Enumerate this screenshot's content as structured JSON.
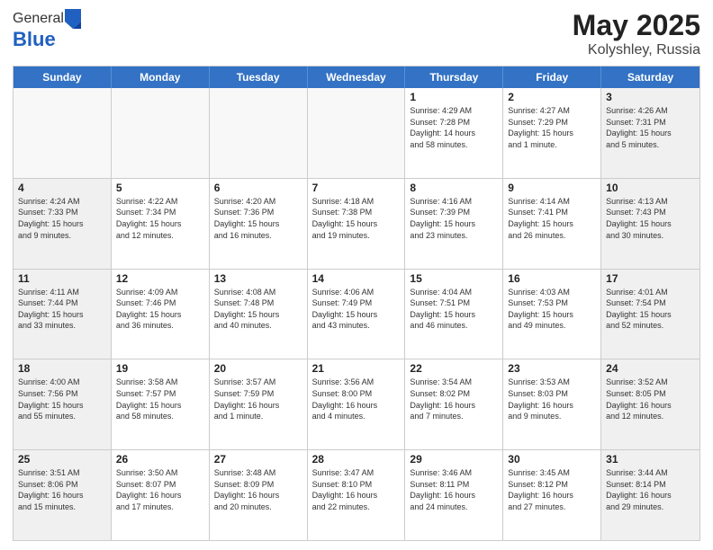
{
  "header": {
    "logo_general": "General",
    "logo_blue": "Blue",
    "title_month": "May 2025",
    "title_location": "Kolyshley, Russia"
  },
  "calendar": {
    "days_of_week": [
      "Sunday",
      "Monday",
      "Tuesday",
      "Wednesday",
      "Thursday",
      "Friday",
      "Saturday"
    ],
    "weeks": [
      [
        {
          "day": "",
          "empty": true
        },
        {
          "day": "",
          "empty": true
        },
        {
          "day": "",
          "empty": true
        },
        {
          "day": "",
          "empty": true
        },
        {
          "day": "1",
          "info": "Sunrise: 4:29 AM\nSunset: 7:28 PM\nDaylight: 14 hours\nand 58 minutes."
        },
        {
          "day": "2",
          "info": "Sunrise: 4:27 AM\nSunset: 7:29 PM\nDaylight: 15 hours\nand 1 minute."
        },
        {
          "day": "3",
          "info": "Sunrise: 4:26 AM\nSunset: 7:31 PM\nDaylight: 15 hours\nand 5 minutes."
        }
      ],
      [
        {
          "day": "4",
          "info": "Sunrise: 4:24 AM\nSunset: 7:33 PM\nDaylight: 15 hours\nand 9 minutes."
        },
        {
          "day": "5",
          "info": "Sunrise: 4:22 AM\nSunset: 7:34 PM\nDaylight: 15 hours\nand 12 minutes."
        },
        {
          "day": "6",
          "info": "Sunrise: 4:20 AM\nSunset: 7:36 PM\nDaylight: 15 hours\nand 16 minutes."
        },
        {
          "day": "7",
          "info": "Sunrise: 4:18 AM\nSunset: 7:38 PM\nDaylight: 15 hours\nand 19 minutes."
        },
        {
          "day": "8",
          "info": "Sunrise: 4:16 AM\nSunset: 7:39 PM\nDaylight: 15 hours\nand 23 minutes."
        },
        {
          "day": "9",
          "info": "Sunrise: 4:14 AM\nSunset: 7:41 PM\nDaylight: 15 hours\nand 26 minutes."
        },
        {
          "day": "10",
          "info": "Sunrise: 4:13 AM\nSunset: 7:43 PM\nDaylight: 15 hours\nand 30 minutes."
        }
      ],
      [
        {
          "day": "11",
          "info": "Sunrise: 4:11 AM\nSunset: 7:44 PM\nDaylight: 15 hours\nand 33 minutes."
        },
        {
          "day": "12",
          "info": "Sunrise: 4:09 AM\nSunset: 7:46 PM\nDaylight: 15 hours\nand 36 minutes."
        },
        {
          "day": "13",
          "info": "Sunrise: 4:08 AM\nSunset: 7:48 PM\nDaylight: 15 hours\nand 40 minutes."
        },
        {
          "day": "14",
          "info": "Sunrise: 4:06 AM\nSunset: 7:49 PM\nDaylight: 15 hours\nand 43 minutes."
        },
        {
          "day": "15",
          "info": "Sunrise: 4:04 AM\nSunset: 7:51 PM\nDaylight: 15 hours\nand 46 minutes."
        },
        {
          "day": "16",
          "info": "Sunrise: 4:03 AM\nSunset: 7:53 PM\nDaylight: 15 hours\nand 49 minutes."
        },
        {
          "day": "17",
          "info": "Sunrise: 4:01 AM\nSunset: 7:54 PM\nDaylight: 15 hours\nand 52 minutes."
        }
      ],
      [
        {
          "day": "18",
          "info": "Sunrise: 4:00 AM\nSunset: 7:56 PM\nDaylight: 15 hours\nand 55 minutes."
        },
        {
          "day": "19",
          "info": "Sunrise: 3:58 AM\nSunset: 7:57 PM\nDaylight: 15 hours\nand 58 minutes."
        },
        {
          "day": "20",
          "info": "Sunrise: 3:57 AM\nSunset: 7:59 PM\nDaylight: 16 hours\nand 1 minute."
        },
        {
          "day": "21",
          "info": "Sunrise: 3:56 AM\nSunset: 8:00 PM\nDaylight: 16 hours\nand 4 minutes."
        },
        {
          "day": "22",
          "info": "Sunrise: 3:54 AM\nSunset: 8:02 PM\nDaylight: 16 hours\nand 7 minutes."
        },
        {
          "day": "23",
          "info": "Sunrise: 3:53 AM\nSunset: 8:03 PM\nDaylight: 16 hours\nand 9 minutes."
        },
        {
          "day": "24",
          "info": "Sunrise: 3:52 AM\nSunset: 8:05 PM\nDaylight: 16 hours\nand 12 minutes."
        }
      ],
      [
        {
          "day": "25",
          "info": "Sunrise: 3:51 AM\nSunset: 8:06 PM\nDaylight: 16 hours\nand 15 minutes."
        },
        {
          "day": "26",
          "info": "Sunrise: 3:50 AM\nSunset: 8:07 PM\nDaylight: 16 hours\nand 17 minutes."
        },
        {
          "day": "27",
          "info": "Sunrise: 3:48 AM\nSunset: 8:09 PM\nDaylight: 16 hours\nand 20 minutes."
        },
        {
          "day": "28",
          "info": "Sunrise: 3:47 AM\nSunset: 8:10 PM\nDaylight: 16 hours\nand 22 minutes."
        },
        {
          "day": "29",
          "info": "Sunrise: 3:46 AM\nSunset: 8:11 PM\nDaylight: 16 hours\nand 24 minutes."
        },
        {
          "day": "30",
          "info": "Sunrise: 3:45 AM\nSunset: 8:12 PM\nDaylight: 16 hours\nand 27 minutes."
        },
        {
          "day": "31",
          "info": "Sunrise: 3:44 AM\nSunset: 8:14 PM\nDaylight: 16 hours\nand 29 minutes."
        }
      ]
    ]
  }
}
